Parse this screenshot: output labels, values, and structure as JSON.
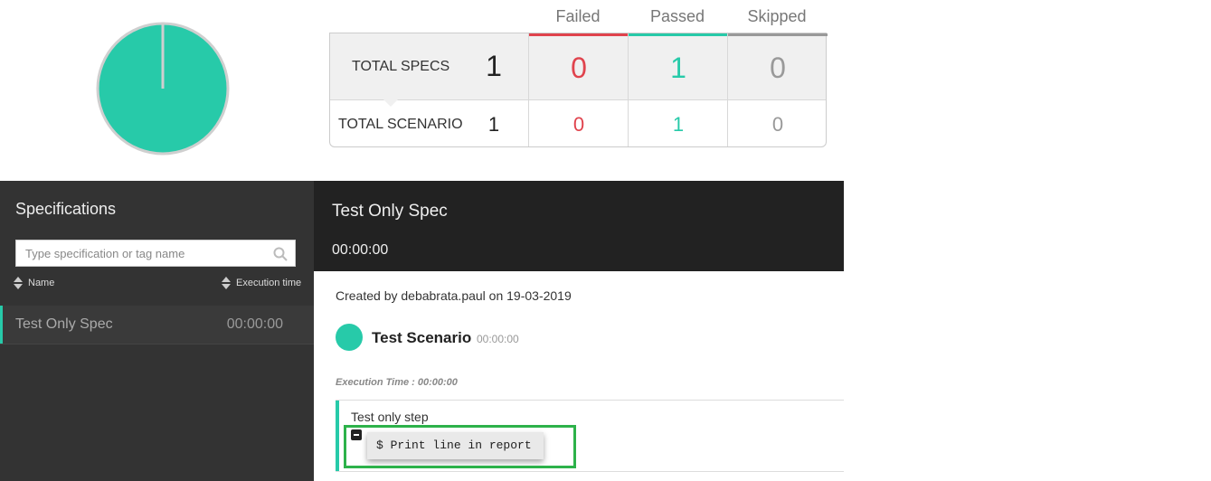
{
  "colors": {
    "passed": "#27caa9",
    "failed": "#e0434d",
    "skipped": "#999999",
    "highlight": "#2db24a"
  },
  "summary": {
    "headers": {
      "failed": "Failed",
      "passed": "Passed",
      "skipped": "Skipped"
    },
    "specs": {
      "label": "TOTAL SPECS",
      "total": "1",
      "failed": "0",
      "passed": "1",
      "skipped": "0"
    },
    "scenario": {
      "label": "TOTAL SCENARIO",
      "total": "1",
      "failed": "0",
      "passed": "1",
      "skipped": "0"
    }
  },
  "pie": {
    "passed_fraction": 1.0
  },
  "sidebar": {
    "title": "Specifications",
    "search_placeholder": "Type specification or tag name",
    "sort_name": "Name",
    "sort_time": "Execution time",
    "specs": [
      {
        "name": "Test Only Spec",
        "time": "00:00:00"
      }
    ]
  },
  "main": {
    "title": "Test Only Spec",
    "time": "00:00:00",
    "created": "Created by debabrata.paul on 19-03-2019",
    "scenario": {
      "name": "Test Scenario",
      "time": "00:00:00"
    },
    "execution_time": "Execution Time : 00:00:00",
    "step": {
      "name": "Test only step",
      "console": "$ Print line in report"
    }
  }
}
